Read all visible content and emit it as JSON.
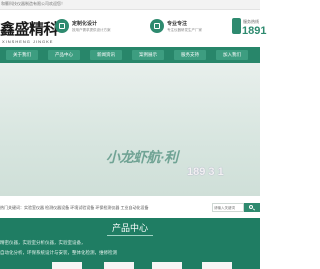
{
  "topbar": {
    "text": "和衢科技仪器制造有限公司欢迎您！"
  },
  "logo": {
    "title": "鑫盛精科",
    "subtitle": "XINSHENG JINGKE"
  },
  "features": [
    {
      "title": "定制化设计",
      "desc": "按用户需求提供设计方案"
    },
    {
      "title": "专业专注",
      "desc": "专注仪器研发生产厂家"
    }
  ],
  "hotline": {
    "label": "服务热线",
    "number": "1891"
  },
  "nav": {
    "items": [
      "关于我们",
      "产品中心",
      "新闻资讯",
      "案例展示",
      "服务支持",
      "加入我们"
    ]
  },
  "banner": {
    "slogan": "小龙虾航·利",
    "phone": "189 3   1"
  },
  "search": {
    "hot": "热门关键词：实验室仪器  检测仪器设备  环境试验设备  环保检测仪器  工业自动化设备",
    "placeholder": "请输入关键词"
  },
  "products": {
    "heading": "产品中心",
    "desc1": "精密仪器，实验室分析仪器，实验室设备，",
    "desc2": "自动化分析，环保系统设计与安装，整体化检测，维修检测"
  }
}
